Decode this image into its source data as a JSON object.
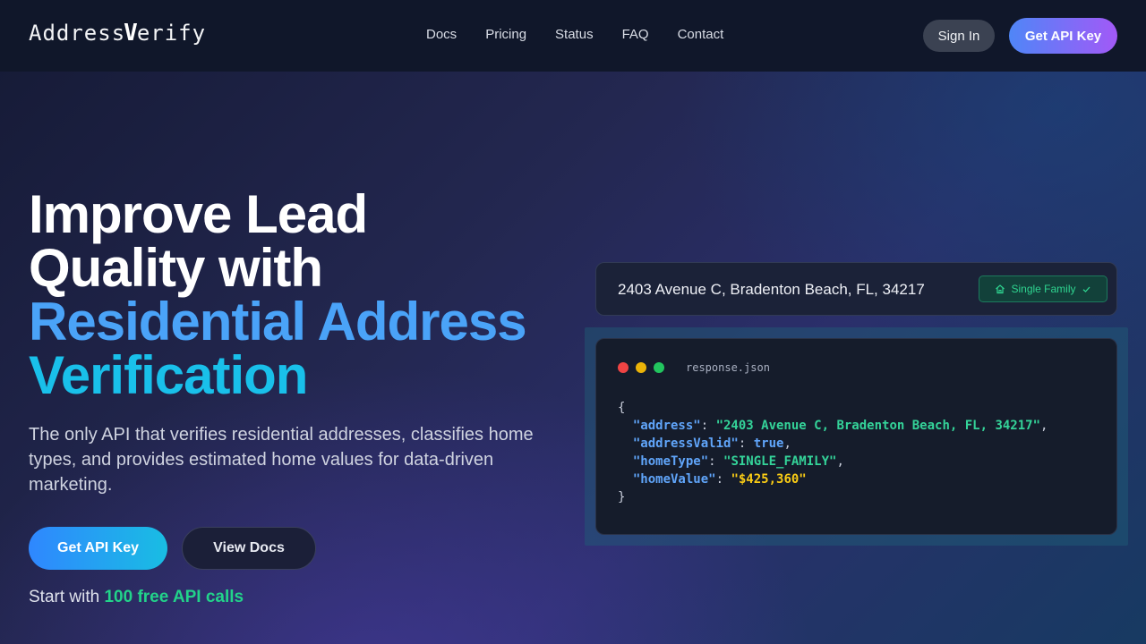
{
  "header": {
    "logo_prefix": "Address",
    "logo_v": "V",
    "logo_suffix": "erify",
    "nav": [
      {
        "label": "Docs"
      },
      {
        "label": "Pricing"
      },
      {
        "label": "Status"
      },
      {
        "label": "FAQ"
      },
      {
        "label": "Contact"
      }
    ],
    "signin_label": "Sign In",
    "getkey_label": "Get API Key"
  },
  "hero": {
    "title_line1": "Improve Lead",
    "title_line2": "Quality with",
    "title_line3": "Residential Address",
    "title_line4": "Verification",
    "subtitle": "The only API that verifies residential addresses, classifies home types, and provides estimated home values for data-driven marketing.",
    "primary_label": "Get API Key",
    "secondary_label": "View Docs",
    "free_prefix": "Start with ",
    "free_highlight": "100 free API calls"
  },
  "demo": {
    "address": "2403 Avenue C, Bradenton Beach, FL, 34217",
    "badge_label": "Single Family",
    "filename": "response.json",
    "json": {
      "open": "{",
      "close": "}",
      "address_key": "\"address\"",
      "address_val": "\"2403 Avenue C, Bradenton Beach, FL, 34217\"",
      "valid_key": "\"addressValid\"",
      "valid_val": "true",
      "type_key": "\"homeType\"",
      "type_val": "\"SINGLE_FAMILY\"",
      "value_key": "\"homeValue\"",
      "value_val": "\"$425,360\""
    }
  },
  "colors": {
    "accent_green": "#22d38a",
    "accent_blue": "#4aa3f8",
    "accent_cyan": "#19c0ea",
    "topbar_bg": "#10172a"
  }
}
